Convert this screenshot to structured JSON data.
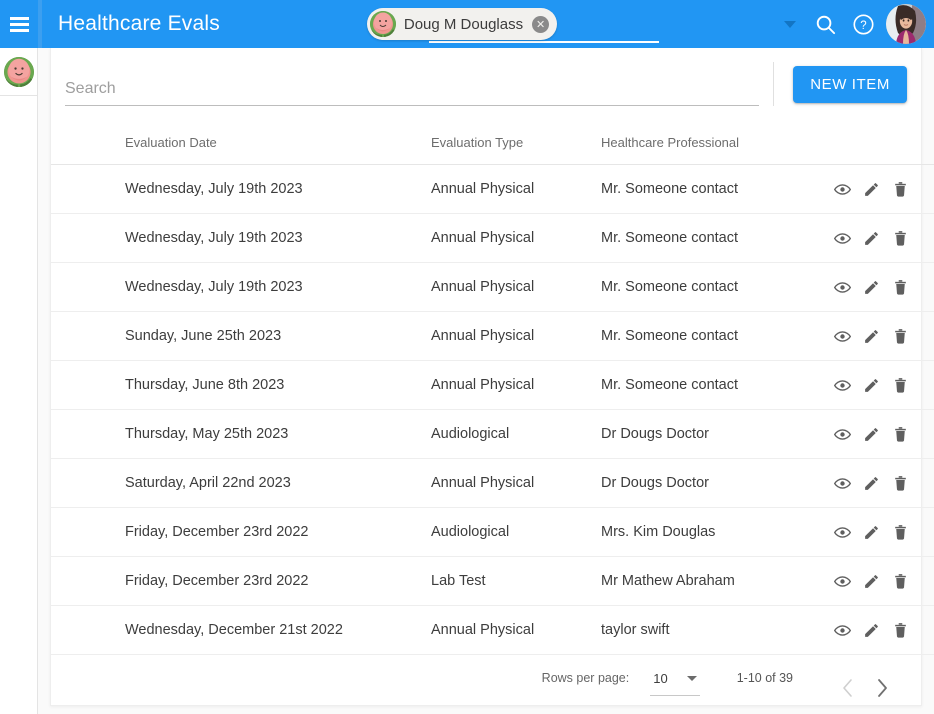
{
  "toolbar": {
    "menu_icon": "hamburger-icon",
    "app_title": "Healthcare Evals",
    "chip": {
      "label": "Doug M Douglass",
      "remove_icon": "close-icon",
      "avatar_icon": "watermelon-avatar"
    },
    "dropdown_icon": "chevron-down-icon",
    "search_icon": "search-icon",
    "help_icon": "help-circle-icon",
    "avatar_icon": "user-avatar",
    "background_color": "#2196f3"
  },
  "left_rail": {
    "avatar_icon": "watermelon-avatar"
  },
  "card_header": {
    "search_placeholder": "Search",
    "search_value": "",
    "new_item_label": "NEW ITEM",
    "new_item_color": "#2196f3"
  },
  "table": {
    "columns": [
      "Evaluation Date",
      "Evaluation Type",
      "Healthcare Professional",
      ""
    ],
    "rows": [
      {
        "date": "Wednesday, July 19th 2023",
        "type": "Annual Physical",
        "professional": "Mr. Someone contact"
      },
      {
        "date": "Wednesday, July 19th 2023",
        "type": "Annual Physical",
        "professional": "Mr. Someone contact"
      },
      {
        "date": "Wednesday, July 19th 2023",
        "type": "Annual Physical",
        "professional": "Mr. Someone contact"
      },
      {
        "date": "Sunday, June 25th 2023",
        "type": "Annual Physical",
        "professional": "Mr. Someone contact"
      },
      {
        "date": "Thursday, June 8th 2023",
        "type": "Annual Physical",
        "professional": "Mr. Someone contact"
      },
      {
        "date": "Thursday, May 25th 2023",
        "type": "Audiological",
        "professional": "Dr Dougs Doctor"
      },
      {
        "date": "Saturday, April 22nd 2023",
        "type": "Annual Physical",
        "professional": "Dr Dougs Doctor"
      },
      {
        "date": "Friday, December 23rd 2022",
        "type": "Audiological",
        "professional": "Mrs. Kim Douglas"
      },
      {
        "date": "Friday, December 23rd 2022",
        "type": "Lab Test",
        "professional": "Mr Mathew Abraham"
      },
      {
        "date": "Wednesday, December 21st 2022",
        "type": "Annual Physical",
        "professional": "taylor swift"
      }
    ],
    "row_actions": [
      "view-icon",
      "edit-icon",
      "delete-icon"
    ]
  },
  "paginator": {
    "rows_per_page_label": "Rows per page:",
    "rows_per_page_value": "10",
    "rows_per_page_caret": "chevron-down-icon",
    "range_label": "1-10 of 39",
    "prev_icon": "chevron-left-icon",
    "next_icon": "chevron-right-icon"
  }
}
